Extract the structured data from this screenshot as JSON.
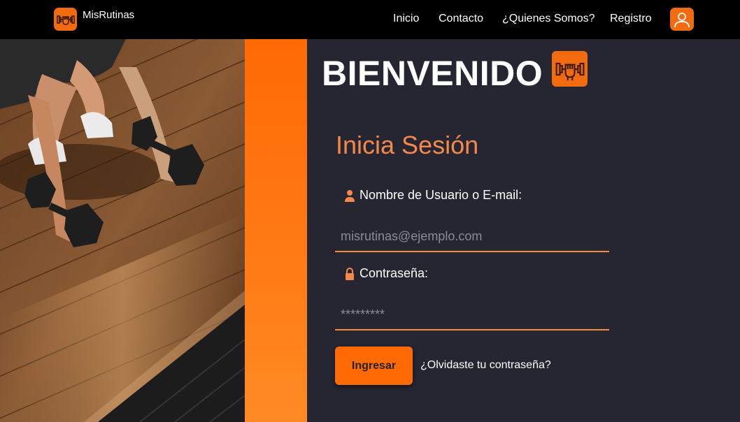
{
  "brand": {
    "name": "MisRutinas",
    "logo_icon": "dumbbell-fist-icon"
  },
  "nav": {
    "links": [
      {
        "label": "Inicio"
      },
      {
        "label": "Contacto"
      },
      {
        "label": "¿Quienes Somos?"
      },
      {
        "label": "Registro"
      }
    ],
    "user_icon": "user-icon"
  },
  "hero": {
    "image": "woman-lifting-dumbbells-on-wood-floor"
  },
  "main": {
    "welcome": "BIENVENIDO",
    "welcome_icon": "dumbbell-fist-icon",
    "login_title": "Inicia Sesión",
    "username": {
      "label": "Nombre de Usuario o E-mail:",
      "placeholder": "misrutinas@ejemplo.com",
      "icon": "person-icon"
    },
    "password": {
      "label": "Contraseña:",
      "placeholder": "*********",
      "icon": "lock-icon"
    },
    "submit_label": "Ingresar",
    "forgot_label": "¿Olvidaste tu contraseña?"
  },
  "colors": {
    "accent": "#f26b0f",
    "accent_text": "#f5894a",
    "background": "#262633",
    "navbar": "#000000"
  }
}
